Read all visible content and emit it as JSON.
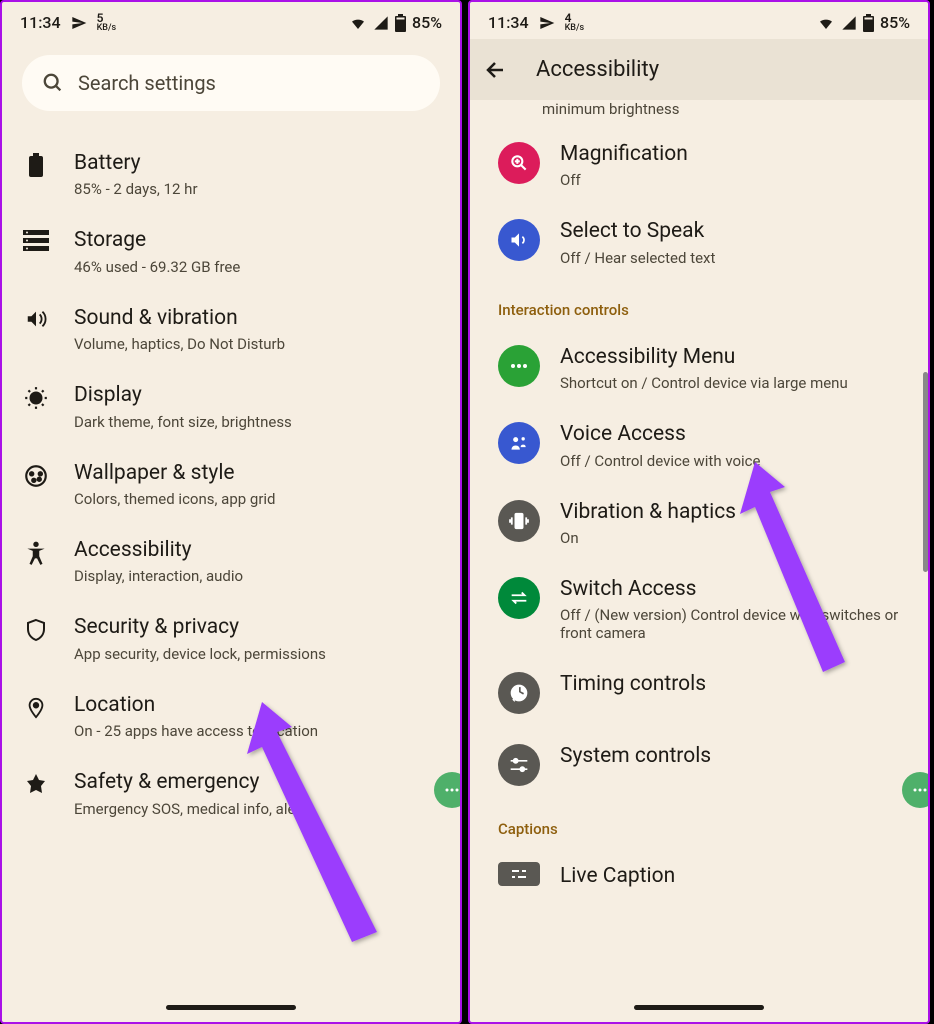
{
  "left": {
    "status": {
      "time": "11:34",
      "kbps": "5",
      "kblabel": "KB/s",
      "battery": "85%"
    },
    "search_placeholder": "Search settings",
    "items": [
      {
        "icon": "battery",
        "title": "Battery",
        "sub": "85% - 2 days, 12 hr"
      },
      {
        "icon": "storage",
        "title": "Storage",
        "sub": "46% used - 69.32 GB free"
      },
      {
        "icon": "sound",
        "title": "Sound & vibration",
        "sub": "Volume, haptics, Do Not Disturb"
      },
      {
        "icon": "display",
        "title": "Display",
        "sub": "Dark theme, font size, brightness"
      },
      {
        "icon": "wallpaper",
        "title": "Wallpaper & style",
        "sub": "Colors, themed icons, app grid"
      },
      {
        "icon": "accessibility",
        "title": "Accessibility",
        "sub": "Display, interaction, audio"
      },
      {
        "icon": "security",
        "title": "Security & privacy",
        "sub": "App security, device lock, permissions"
      },
      {
        "icon": "location",
        "title": "Location",
        "sub": "On - 25 apps have access to location"
      },
      {
        "icon": "safety",
        "title": "Safety & emergency",
        "sub": "Emergency SOS, medical info, alerts"
      }
    ]
  },
  "right": {
    "status": {
      "time": "11:34",
      "kbps": "4",
      "kblabel": "KB/s",
      "battery": "85%"
    },
    "header": "Accessibility",
    "partial_top": "minimum brightness",
    "section1_label": "Interaction controls",
    "section2_label": "Captions",
    "items_top": [
      {
        "color": "red",
        "title": "Magnification",
        "sub": "Off"
      },
      {
        "color": "blue",
        "title": "Select to Speak",
        "sub": "Off / Hear selected text"
      }
    ],
    "items_mid": [
      {
        "color": "green",
        "title": "Accessibility Menu",
        "sub": "Shortcut on / Control device via large menu"
      },
      {
        "color": "blue",
        "title": "Voice Access",
        "sub": "Off / Control device with voice"
      },
      {
        "color": "grey",
        "title": "Vibration & haptics",
        "sub": "On"
      },
      {
        "color": "dgreen",
        "title": "Switch Access",
        "sub": "Off / (New version) Control device with switches or front camera"
      },
      {
        "color": "grey",
        "title": "Timing controls",
        "sub": ""
      },
      {
        "color": "grey",
        "title": "System controls",
        "sub": ""
      }
    ],
    "items_bot": [
      {
        "color": "grey",
        "title": "Live Caption",
        "sub": ""
      }
    ]
  }
}
